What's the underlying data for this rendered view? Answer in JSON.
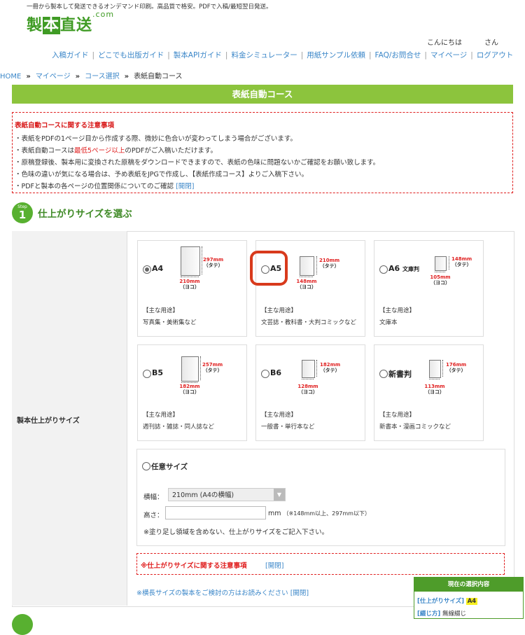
{
  "header": {
    "tagline": "一冊から製本して発送できるオンデマンド印刷。高品質で格安。PDFで入稿/最短翌日発送。",
    "logo_main": "製",
    "logo_box": "本",
    "logo_rest": "直送",
    "logo_com": ".com",
    "greeting": "こんにちは",
    "greeting_suffix": "さん"
  },
  "nav": [
    "入稿ガイド",
    "どこでも出版ガイド",
    "製本APIガイド",
    "料金シミュレーター",
    "用紙サンプル依頼",
    "FAQ/お問合せ",
    "マイページ",
    "ログアウト"
  ],
  "breadcrumb": {
    "home": "HOME",
    "mypage": "マイページ",
    "course_select": "コース選択",
    "current": "表紙自動コース",
    "sep": "»"
  },
  "page_title": "表紙自動コース",
  "notice": {
    "title": "表紙自動コースに関する注意事項",
    "line1": "・表紙をPDFの1ページ目から作成する際、微妙に色合いが変わってしまう場合がございます。",
    "line2_pre": "・表紙自動コースは",
    "line2_red": "最低5ページ以上",
    "line2_post": "のPDFがご入稿いただけます。",
    "line3": "・原稿登録後、製本用に変換された原稿をダウンロードできますので、表紙の色味に問題ないかご確認をお願い致します。",
    "line4": "・色味の違いが気になる場合は、予め表紙をJPGで作成し、【表紙作成コース】よりご入稿下さい。",
    "line5_pre": "・PDFと製本の各ページの位置関係についてのご確認",
    "line5_link": "[開閉]"
  },
  "step1": {
    "step_label": "Step",
    "step_num": "1",
    "title": "仕上がりサイズを選ぶ"
  },
  "row_label": "製本仕上がりサイズ",
  "use_label": "【主な用途】",
  "sizes": [
    {
      "name": "A4",
      "sub": "",
      "h": "297mm",
      "w": "210mm",
      "use": "写真集・美術集など",
      "selected": true
    },
    {
      "name": "A5",
      "sub": "",
      "h": "210mm",
      "w": "148mm",
      "use": "文芸誌・教科書・大判コミックなど",
      "selected": false
    },
    {
      "name": "A6",
      "sub": "文庫判",
      "h": "148mm",
      "w": "105mm",
      "use": "文庫本",
      "selected": false
    },
    {
      "name": "B5",
      "sub": "",
      "h": "257mm",
      "w": "182mm",
      "use": "週刊誌・雑誌・同人誌など",
      "selected": false
    },
    {
      "name": "B6",
      "sub": "",
      "h": "182mm",
      "w": "128mm",
      "use": "一般書・単行本など",
      "selected": false
    },
    {
      "name": "新書判",
      "sub": "",
      "h": "176mm",
      "w": "113mm",
      "use": "新書本・漫画コミックなど",
      "selected": false
    }
  ],
  "dim_labels": {
    "tate": "（タテ）",
    "yoko": "（ヨコ）"
  },
  "custom": {
    "title": "任意サイズ",
    "width_label": "横幅：",
    "width_value": "210mm (A4の横幅)",
    "height_label": "高さ：",
    "height_value": "",
    "unit": "mm",
    "range": "（※148mm以上、297mm以下）",
    "note": "※塗り足し領域を含めない、仕上がりサイズをご記入下さい。"
  },
  "size_notice": {
    "title": "※仕上がりサイズに関する注意事項",
    "toggle": "[開閉]"
  },
  "long_note": "※横長サイズの製本をご検討の方はお読みください [開閉]",
  "selection_panel": {
    "title": "現在の選択内容",
    "size_key": "[仕上がりサイズ]",
    "size_val": "A4",
    "bind_key": "[綴じ方]",
    "bind_val": "無線綴じ"
  }
}
